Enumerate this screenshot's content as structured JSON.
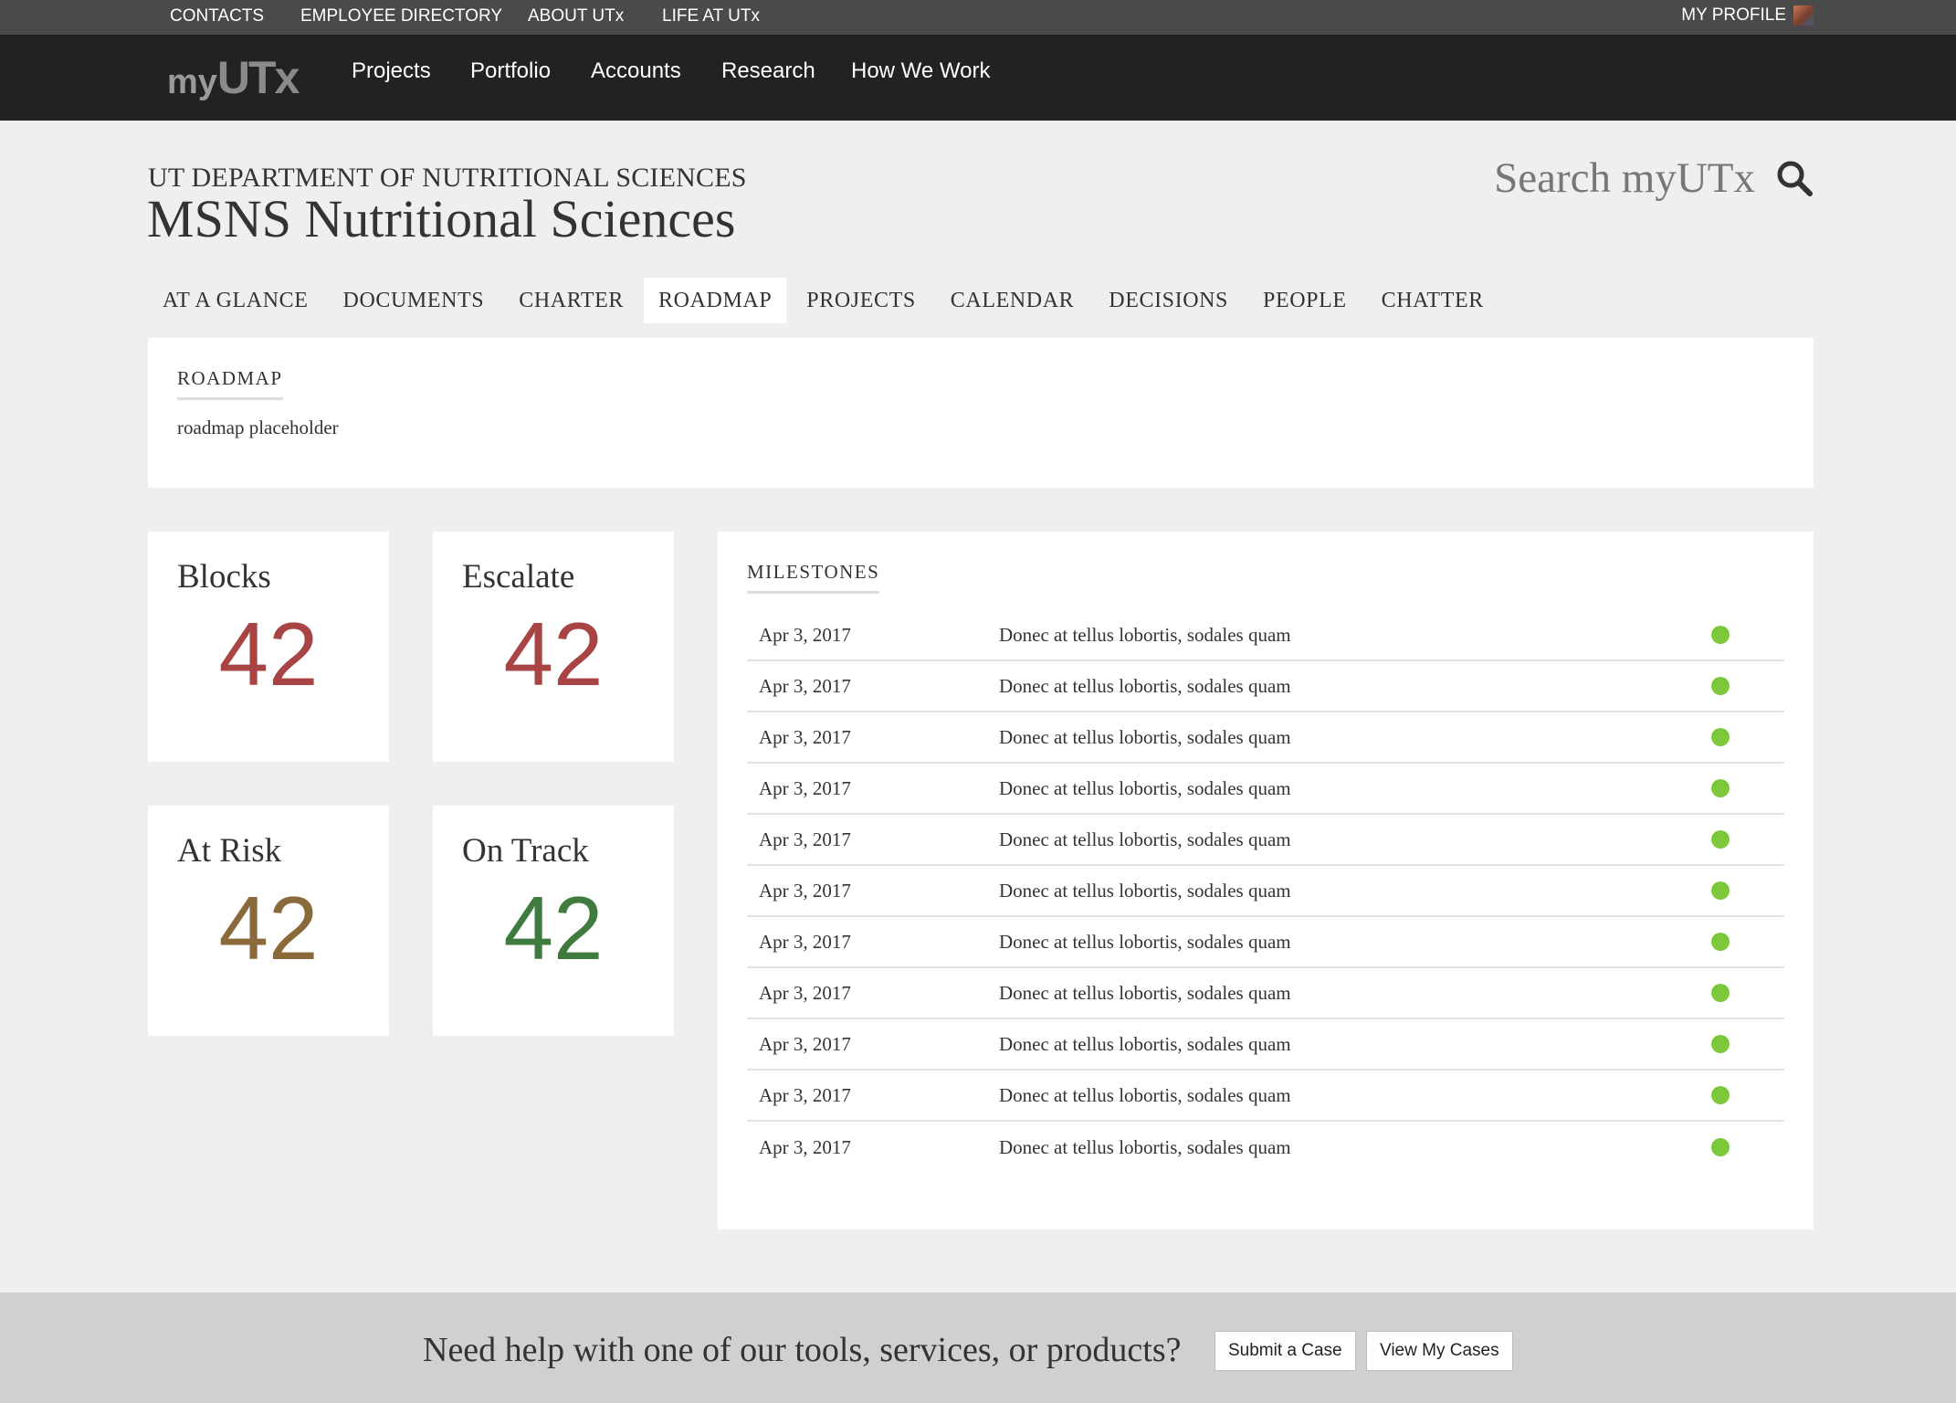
{
  "utility_bar": {
    "links": [
      "CONTACTS",
      "EMPLOYEE DIRECTORY",
      "ABOUT UTx",
      "LIFE AT UTx"
    ],
    "profile_label": "MY PROFILE"
  },
  "brand": {
    "my": "my",
    "utx": "UTx"
  },
  "main_nav": [
    "Projects",
    "Portfolio",
    "Accounts",
    "Research",
    "How We Work"
  ],
  "header": {
    "department": "UT DEPARTMENT OF NUTRITIONAL SCIENCES",
    "project_title": "MSNS Nutritional Sciences",
    "search_label": "Search myUTx"
  },
  "tabs": [
    "AT A GLANCE",
    "DOCUMENTS",
    "CHARTER",
    "ROADMAP",
    "PROJECTS",
    "CALENDAR",
    "DECISIONS",
    "PEOPLE",
    "CHATTER"
  ],
  "active_tab": "ROADMAP",
  "roadmap": {
    "label": "ROADMAP",
    "placeholder": "roadmap placeholder"
  },
  "stats": [
    {
      "label": "Blocks",
      "value": "42",
      "color": "#a84444"
    },
    {
      "label": "Escalate",
      "value": "42",
      "color": "#a84444"
    },
    {
      "label": "At Risk",
      "value": "42",
      "color": "#8a6a3a"
    },
    {
      "label": "On Track",
      "value": "42",
      "color": "#3f7a3f"
    }
  ],
  "milestones": {
    "label": "MILESTONES",
    "status_color": "#7bc83a",
    "rows": [
      {
        "date": "Apr 3, 2017",
        "desc": "Donec at tellus lobortis, sodales quam"
      },
      {
        "date": "Apr 3, 2017",
        "desc": "Donec at tellus lobortis, sodales quam"
      },
      {
        "date": "Apr 3, 2017",
        "desc": "Donec at tellus lobortis, sodales quam"
      },
      {
        "date": "Apr 3, 2017",
        "desc": "Donec at tellus lobortis, sodales quam"
      },
      {
        "date": "Apr 3, 2017",
        "desc": "Donec at tellus lobortis, sodales quam"
      },
      {
        "date": "Apr 3, 2017",
        "desc": "Donec at tellus lobortis, sodales quam"
      },
      {
        "date": "Apr 3, 2017",
        "desc": "Donec at tellus lobortis, sodales quam"
      },
      {
        "date": "Apr 3, 2017",
        "desc": "Donec at tellus lobortis, sodales quam"
      },
      {
        "date": "Apr 3, 2017",
        "desc": "Donec at tellus lobortis, sodales quam"
      },
      {
        "date": "Apr 3, 2017",
        "desc": "Donec at tellus lobortis, sodales quam"
      },
      {
        "date": "Apr 3, 2017",
        "desc": "Donec at tellus lobortis, sodales quam"
      }
    ]
  },
  "footer": {
    "text": "Need help with one of our tools, services, or products?",
    "submit_label": "Submit a Case",
    "view_label": "View My Cases"
  }
}
